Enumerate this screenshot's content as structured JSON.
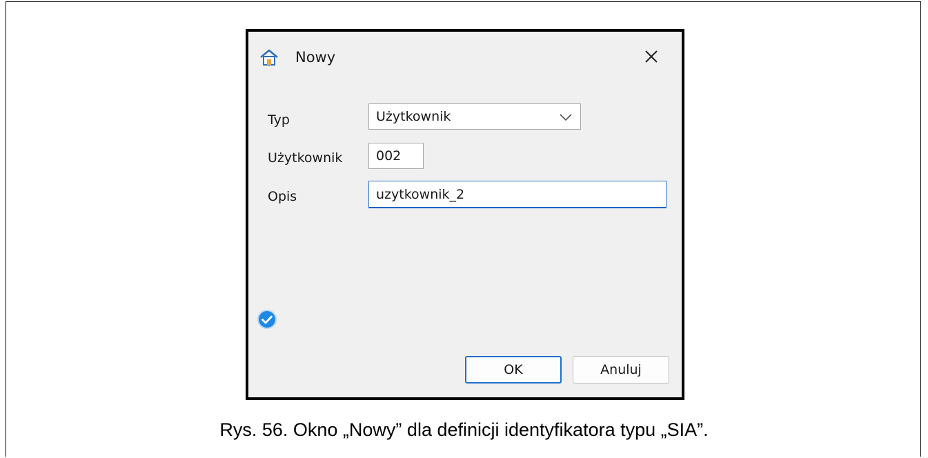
{
  "dialog": {
    "title": "Nowy",
    "title_icon": "home-icon",
    "close_icon": "close-icon",
    "fields": {
      "type_label": "Typ",
      "type_value": "Użytkownik",
      "user_label": "Użytkownik",
      "user_value": "002",
      "description_label": "Opis",
      "description_value": "uzytkownik_2"
    },
    "status_icon": "check-circle-icon",
    "buttons": {
      "ok_label": "OK",
      "cancel_label": "Anuluj"
    },
    "colors": {
      "accent": "#1f6fc9",
      "dialog_background": "#f0f0f0",
      "status_icon": "#1e88e5"
    }
  },
  "caption": "Rys. 56. Okno „Nowy” dla definicji identyfikatora typu „SIA”."
}
